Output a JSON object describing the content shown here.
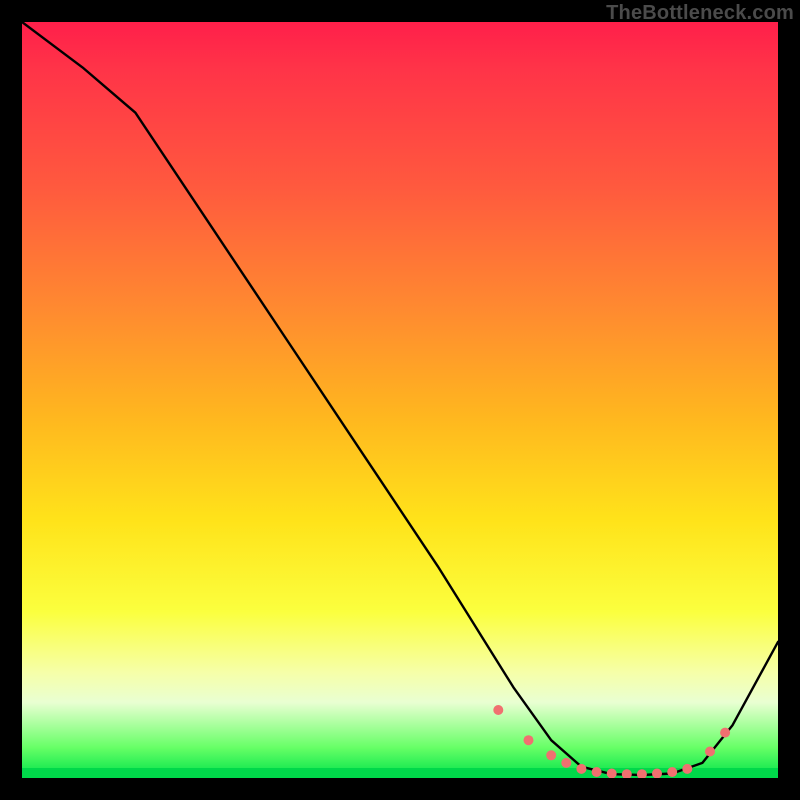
{
  "watermark": "TheBottleneck.com",
  "chart_data": {
    "type": "line",
    "title": "",
    "xlabel": "",
    "ylabel": "",
    "xlim": [
      0,
      100
    ],
    "ylim": [
      0,
      100
    ],
    "grid": false,
    "legend": false,
    "series": [
      {
        "name": "curve",
        "color": "#000000",
        "x": [
          0,
          4,
          8,
          15,
          25,
          35,
          45,
          55,
          60,
          65,
          70,
          74,
          78,
          82,
          86,
          90,
          94,
          100
        ],
        "y": [
          100,
          97,
          94,
          88,
          73,
          58,
          43,
          28,
          20,
          12,
          5,
          1.5,
          0.5,
          0.4,
          0.6,
          2,
          7,
          18
        ]
      }
    ],
    "markers": {
      "name": "flat-region-dots",
      "color": "#f07070",
      "radius_px": 5,
      "x": [
        63,
        67,
        70,
        72,
        74,
        76,
        78,
        80,
        82,
        84,
        86,
        88,
        91,
        93
      ],
      "y": [
        9,
        5,
        3,
        2,
        1.2,
        0.8,
        0.6,
        0.5,
        0.5,
        0.6,
        0.8,
        1.2,
        3.5,
        6
      ]
    },
    "background_gradient": {
      "orientation": "vertical",
      "stops": [
        {
          "pos": 0.0,
          "color": "#ff1f4a"
        },
        {
          "pos": 0.38,
          "color": "#ff8a30"
        },
        {
          "pos": 0.66,
          "color": "#ffe31a"
        },
        {
          "pos": 0.86,
          "color": "#f6ffa8"
        },
        {
          "pos": 0.96,
          "color": "#66ff66"
        },
        {
          "pos": 1.0,
          "color": "#00d84a"
        }
      ]
    }
  }
}
